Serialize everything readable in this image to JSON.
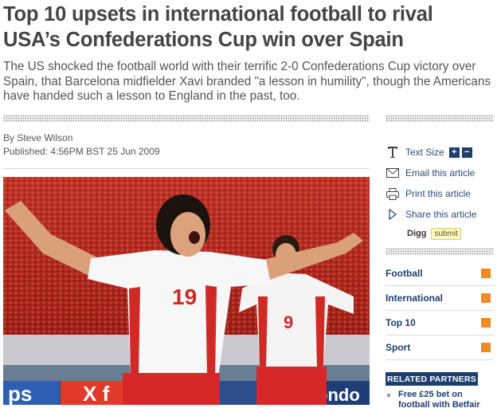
{
  "article": {
    "headline": "Top 10 upsets in international football to rival USA’s Confederations Cup win over Spain",
    "standfirst": "The US shocked the football world with their terrific 2-0 Confederations Cup victory over Spain, that Barcelona midfielder Xavi branded \"a lesson in humility\", though the Americans have handed such a lesson to England in the past, too.",
    "byline": "By Steve Wilson",
    "published": "Published: 4:56PM BST 25 Jun 2009",
    "photo": {
      "player_number_front": "19",
      "player_number_back": "9",
      "banner_text_left": "ps",
      "banner_text_mid": "X f",
      "banner_text_right": "ondo"
    }
  },
  "tools": {
    "text_size_label": "Text Size",
    "increase_label": "+",
    "decrease_label": "−",
    "email_label": "Email this article",
    "print_label": "Print this article",
    "share_label": "Share this article",
    "digg_label": "Digg",
    "digg_submit_label": "submit"
  },
  "topics": [
    {
      "label": "Football",
      "icon": "rss-icon"
    },
    {
      "label": "International",
      "icon": "rss-icon"
    },
    {
      "label": "Top 10",
      "icon": "rss-icon"
    },
    {
      "label": "Sport",
      "icon": "rss-icon"
    }
  ],
  "partners": {
    "title": "RELATED PARTNERS",
    "link": "Free £25 bet on football with Betfair"
  },
  "colors": {
    "headline": "#444444",
    "link": "#1d3f6e",
    "rss": "#f08a24",
    "partners_bg": "#1d3f6e"
  }
}
